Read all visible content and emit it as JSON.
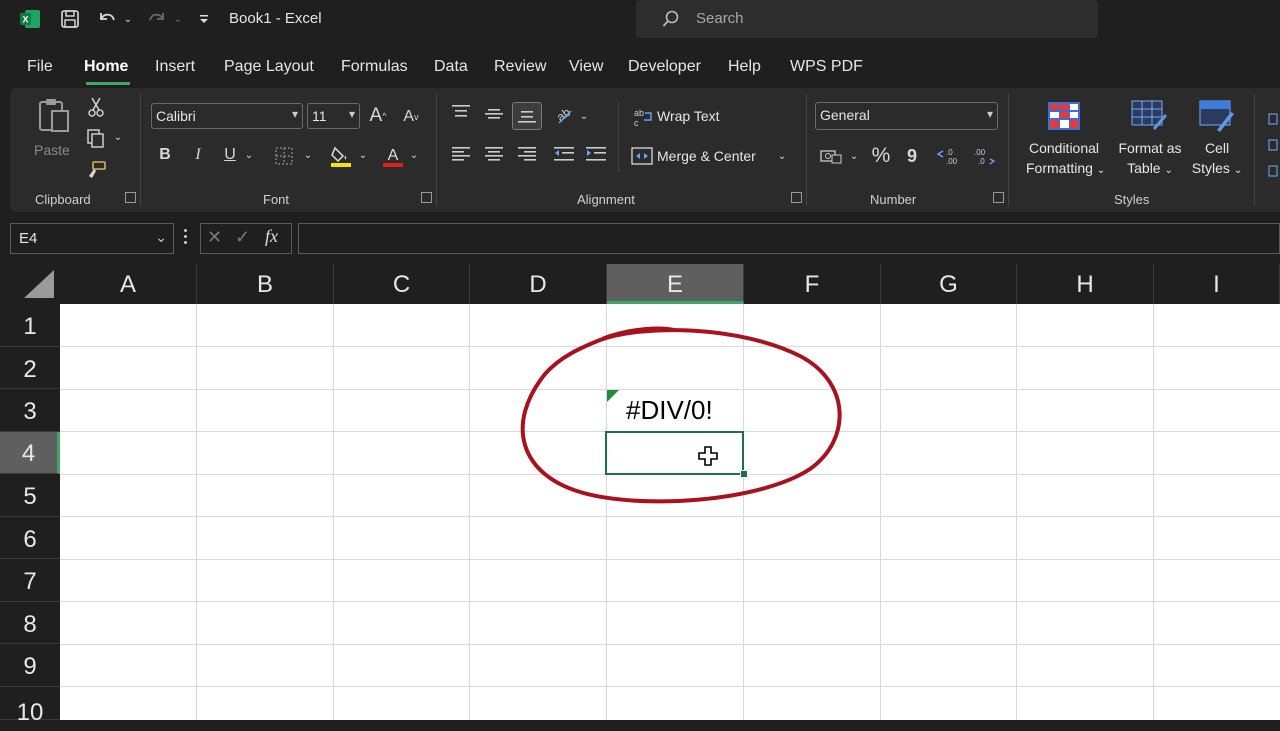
{
  "titlebar": {
    "title": "Book1  -  Excel",
    "search_placeholder": "Search",
    "app_icon": "excel-icon",
    "accent": "#3fa66a"
  },
  "menu": {
    "tabs": [
      "File",
      "Home",
      "Insert",
      "Page Layout",
      "Formulas",
      "Data",
      "Review",
      "View",
      "Developer",
      "Help",
      "WPS PDF"
    ],
    "active": "Home"
  },
  "ribbon": {
    "clipboard": {
      "label": "Clipboard",
      "paste": "Paste"
    },
    "font": {
      "label": "Font",
      "font_name": "Calibri",
      "font_size": "11",
      "grow": "A",
      "shrink": "A",
      "bold": "B",
      "italic": "I",
      "underline": "U"
    },
    "alignment": {
      "label": "Alignment",
      "wrap_text": "Wrap Text",
      "merge_center": "Merge & Center"
    },
    "number": {
      "label": "Number",
      "format": "General",
      "percent": "%",
      "comma": "9"
    },
    "styles": {
      "label": "Styles",
      "conditional_1": "Conditional",
      "conditional_2": "Formatting",
      "format_table_1": "Format as",
      "format_table_2": "Table",
      "cell_styles_1": "Cell",
      "cell_styles_2": "Styles"
    }
  },
  "formula_bar": {
    "name_box": "E4",
    "formula": ""
  },
  "sheet": {
    "columns": [
      "A",
      "B",
      "C",
      "D",
      "E",
      "F",
      "G",
      "H",
      "I"
    ],
    "rows": [
      "1",
      "2",
      "3",
      "4",
      "5",
      "6",
      "7",
      "8",
      "9",
      "10"
    ],
    "selected_column": "E",
    "selected_row": "4",
    "cell_E3": "#DIV/0!"
  }
}
